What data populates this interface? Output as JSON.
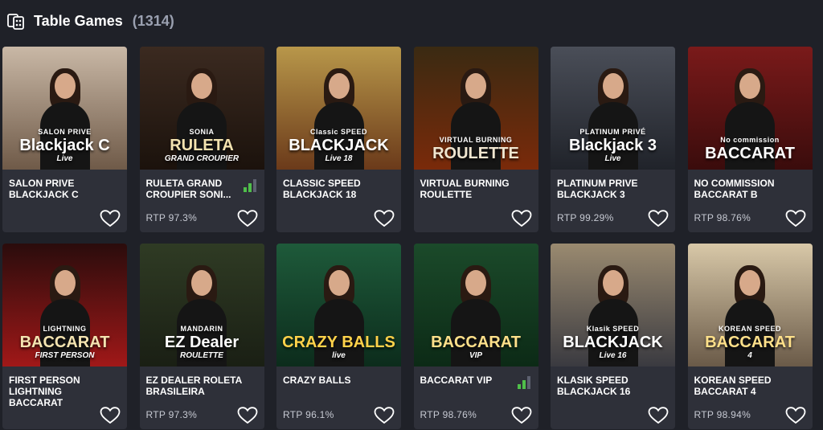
{
  "header": {
    "icon": "table-games-icon",
    "title": "Table Games",
    "count": "(1314)"
  },
  "colors": {
    "background": "#1f2128",
    "card": "#2e3039",
    "muted_text": "#9aa0b0",
    "signal_green": "#4fbf4a"
  },
  "games": [
    {
      "name": "SALON PRIVE BLACKJACK C",
      "rtp": "",
      "logo_sub": "SALON PRIVE",
      "logo_main": "Blackjack C",
      "logo_tag": "Live",
      "bg": "linear-gradient(180deg,#c9b8a6,#6f5a48)",
      "signal": 0
    },
    {
      "name": "RULETA GRAND CROUPIER SONI...",
      "rtp": "RTP 97.3%",
      "logo_sub": "SONIA",
      "logo_main": "RULETA",
      "logo_tag": "GRAND CROUPIER",
      "bg": "linear-gradient(180deg,#3b2a20,#1b120c)",
      "signal": 2
    },
    {
      "name": "CLASSIC SPEED BLACKJACK 18",
      "rtp": "",
      "logo_sub": "Classic SPEED",
      "logo_main": "BLACKJACK",
      "logo_tag": "Live 18",
      "bg": "linear-gradient(180deg,#b8974a,#6b3a1a)",
      "signal": 0
    },
    {
      "name": "VIRTUAL BURNING ROULETTE",
      "rtp": "",
      "logo_sub": "VIRTUAL BURNING",
      "logo_main": "ROULETTE",
      "logo_tag": "",
      "bg": "linear-gradient(180deg,#3a2a12,#7a2a0a)",
      "signal": 0
    },
    {
      "name": "PLATINUM PRIVE BLACKJACK 3",
      "rtp": "RTP 99.29%",
      "logo_sub": "PLATINUM PRIVÉ",
      "logo_main": "Blackjack 3",
      "logo_tag": "Live",
      "bg": "linear-gradient(180deg,#4a4e58,#20232a)",
      "signal": 0
    },
    {
      "name": "NO COMMISSION BACCARAT B",
      "rtp": "RTP 98.76%",
      "logo_sub": "No commission",
      "logo_main": "BACCARAT",
      "logo_tag": "",
      "bg": "linear-gradient(180deg,#7a1a1a,#3a0c0c)",
      "signal": 0
    },
    {
      "name": "FIRST PERSON LIGHTNING BACCARAT",
      "rtp": "",
      "logo_sub": "LIGHTNING",
      "logo_main": "BACCARAT",
      "logo_tag": "FIRST PERSON",
      "bg": "linear-gradient(180deg,#2a0c0c,#a01818)",
      "signal": 0
    },
    {
      "name": "EZ DEALER ROLETA BRASILEIRA",
      "rtp": "RTP 97.3%",
      "logo_sub": "MANDARIN",
      "logo_main": "EZ Dealer",
      "logo_tag": "ROULETTE",
      "bg": "linear-gradient(180deg,#2f3b24,#1a1f14)",
      "signal": 0
    },
    {
      "name": "CRAZY BALLS",
      "rtp": "RTP 96.1%",
      "logo_sub": "",
      "logo_main": "CRAZY BALLS",
      "logo_tag": "live",
      "bg": "linear-gradient(180deg,#1e5a3a,#0c2c1c)",
      "signal": 0
    },
    {
      "name": "BACCARAT VIP",
      "rtp": "RTP 98.76%",
      "logo_sub": "",
      "logo_main": "BACCARAT",
      "logo_tag": "VIP",
      "bg": "linear-gradient(180deg,#1b4a2a,#0c2a16)",
      "signal": 2
    },
    {
      "name": "KLASIK SPEED BLACKJACK 16",
      "rtp": "",
      "logo_sub": "Klasik SPEED",
      "logo_main": "BLACKJACK",
      "logo_tag": "Live 16",
      "bg": "linear-gradient(180deg,#9a8a70,#3a3a40)",
      "signal": 0
    },
    {
      "name": "KOREAN SPEED BACCARAT 4",
      "rtp": "RTP 98.94%",
      "logo_sub": "KOREAN SPEED",
      "logo_main": "BACCARAT",
      "logo_tag": "4",
      "bg": "linear-gradient(180deg,#d8c8a8,#6a5a48)",
      "signal": 0
    }
  ]
}
